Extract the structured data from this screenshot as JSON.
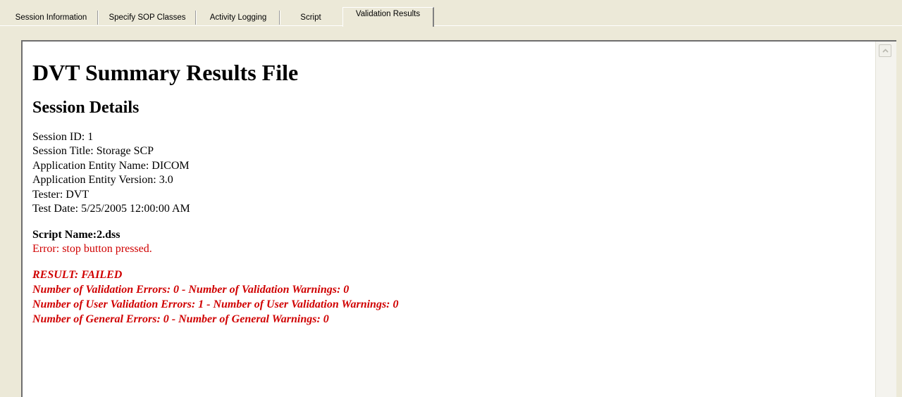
{
  "tabs": [
    {
      "label": "Session Information",
      "active": false
    },
    {
      "label": "Specify SOP Classes",
      "active": false
    },
    {
      "label": "Activity Logging",
      "active": false
    },
    {
      "label": "Script",
      "active": false
    },
    {
      "label": "Validation Results",
      "active": true
    }
  ],
  "document": {
    "title": "DVT Summary Results File",
    "section_heading": "Session Details",
    "details": [
      "Session ID: 1",
      "Session Title: Storage SCP",
      "Application Entity Name: DICOM",
      "Application Entity Version: 3.0",
      "Tester: DVT",
      "Test Date: 5/25/2005 12:00:00 AM"
    ],
    "script_name": "Script Name:2.dss",
    "error_message": "Error: stop button pressed.",
    "result_lines": [
      "RESULT: FAILED",
      "Number of Validation Errors: 0 - Number of Validation Warnings: 0",
      "Number of User Validation Errors: 1 - Number of User Validation Warnings: 0",
      "Number of General Errors: 0 - Number of General Warnings: 0"
    ]
  },
  "scrollbar": {
    "up_icon": "chevron-up-icon"
  },
  "colors": {
    "error_red": "#d00000",
    "window_bg": "#ece9d8",
    "document_bg": "#ffffff"
  }
}
